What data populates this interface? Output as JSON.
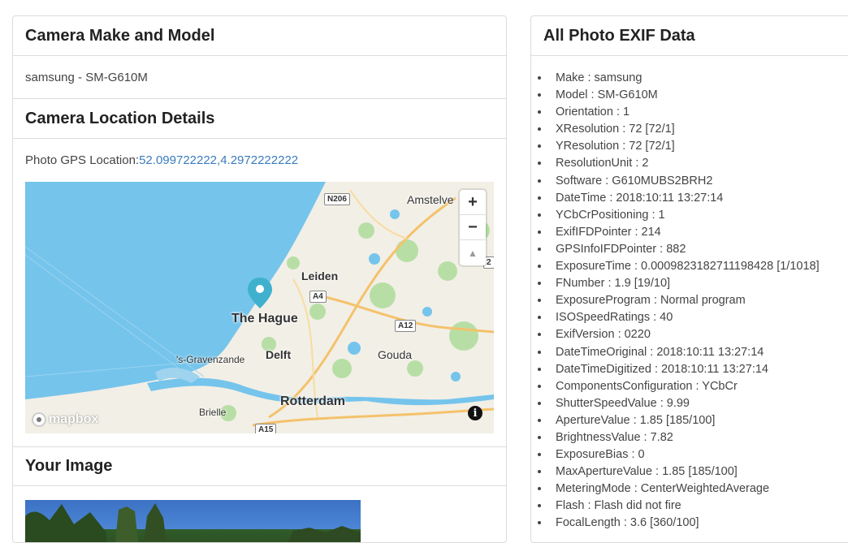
{
  "camera": {
    "header": "Camera Make and Model",
    "make_model": "samsung - SM-G610M"
  },
  "location": {
    "header": "Camera Location Details",
    "gps_label": "Photo GPS Location: ",
    "gps_value": "52.099722222,4.2972222222"
  },
  "map": {
    "zoom_in": "+",
    "zoom_out": "−",
    "compass": "▲",
    "logo_text": "mapbox",
    "info": "i",
    "labels": {
      "amstelveen": "Amstelve",
      "leiden": "Leiden",
      "the_hague": "The Hague",
      "s_gravenzande": "'s-Gravenzande",
      "delft": "Delft",
      "gouda": "Gouda",
      "rotterdam": "Rotterdam",
      "brielle": "Brielle"
    },
    "roads": {
      "n206": "N206",
      "a4": "A4",
      "a12": "A12",
      "a15": "A15",
      "r2": "2"
    },
    "colors": {
      "water": "#75c4ec",
      "land": "#f2efe6",
      "green": "#b7dfa5",
      "marker": "#3fb1ce"
    }
  },
  "image": {
    "header": "Your Image"
  },
  "exif": {
    "header": "All Photo EXIF Data",
    "items": [
      "Make : samsung",
      "Model : SM-G610M",
      "Orientation : 1",
      "XResolution : 72 [72/1]",
      "YResolution : 72 [72/1]",
      "ResolutionUnit : 2",
      "Software : G610MUBS2BRH2",
      "DateTime : 2018:10:11 13:27:14",
      "YCbCrPositioning : 1",
      "ExifIFDPointer : 214",
      "GPSInfoIFDPointer : 882",
      "ExposureTime : 0.0009823182711198428 [1/1018]",
      "FNumber : 1.9 [19/10]",
      "ExposureProgram : Normal program",
      "ISOSpeedRatings : 40",
      "ExifVersion : 0220",
      "DateTimeOriginal : 2018:10:11 13:27:14",
      "DateTimeDigitized : 2018:10:11 13:27:14",
      "ComponentsConfiguration : YCbCr",
      "ShutterSpeedValue : 9.99",
      "ApertureValue : 1.85 [185/100]",
      "BrightnessValue : 7.82",
      "ExposureBias : 0",
      "MaxApertureValue : 1.85 [185/100]",
      "MeteringMode : CenterWeightedAverage",
      "Flash : Flash did not fire",
      "FocalLength : 3.6 [360/100]"
    ]
  }
}
